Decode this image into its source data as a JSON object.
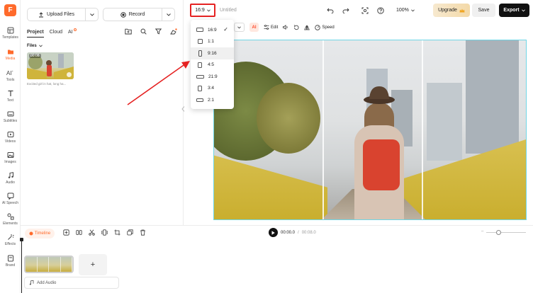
{
  "nav": {
    "logo": "F",
    "items": [
      {
        "label": "Templates",
        "icon": "templates-icon"
      },
      {
        "label": "Media",
        "icon": "media-icon"
      },
      {
        "label": "Tools",
        "icon": "ai-tools-icon"
      },
      {
        "label": "Text",
        "icon": "text-icon"
      },
      {
        "label": "Subtitles",
        "icon": "subtitles-icon"
      },
      {
        "label": "Videos",
        "icon": "videos-icon"
      },
      {
        "label": "Images",
        "icon": "images-icon"
      },
      {
        "label": "Audio",
        "icon": "audio-icon"
      },
      {
        "label": "AI Speech",
        "icon": "ai-speech-icon"
      },
      {
        "label": "Elements",
        "icon": "elements-icon"
      },
      {
        "label": "Effects",
        "icon": "effects-icon"
      },
      {
        "label": "Brand",
        "icon": "brand-icon"
      }
    ],
    "active_index": 1
  },
  "panel": {
    "upload_label": "Upload Files",
    "record_label": "Record",
    "tabs": [
      "Project",
      "Cloud",
      "AI"
    ],
    "files_label": "Files",
    "thumb": {
      "duration": "00:08",
      "caption": "Excited girl in hat, long ha..."
    }
  },
  "header": {
    "ratio": "16:9",
    "title": "Untitled",
    "zoom": "100%",
    "upgrade": "Upgrade",
    "save": "Save",
    "export": "Export"
  },
  "toolbar": {
    "ai": "AI",
    "edit": "Edit",
    "speed": "Speed"
  },
  "ratio_menu": {
    "options": [
      "16:9",
      "1:1",
      "9:16",
      "4:5",
      "21:9",
      "3:4",
      "2:1"
    ],
    "selected": "16:9",
    "hovered": "9:16"
  },
  "timeline": {
    "label": "Timeline",
    "time_current": "00:00.0",
    "time_separator": "/",
    "time_total": "00:08.0",
    "add_audio": "Add Audio",
    "add_clip": "+"
  },
  "colors": {
    "accent": "#ff6a2b",
    "annotation": "#e52222",
    "export_bg": "#111111",
    "canvas_border": "#6fd6e6"
  }
}
